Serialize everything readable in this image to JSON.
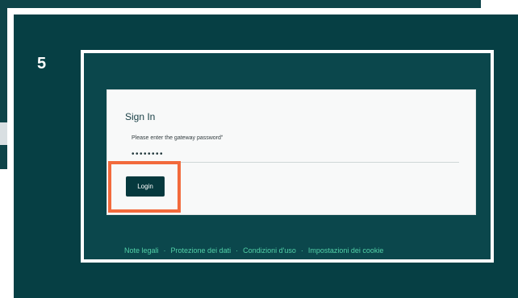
{
  "step": {
    "number": "5"
  },
  "signin": {
    "title": "Sign In",
    "password_label": "Please enter the gateway password",
    "required_marker": "*",
    "password_value": "••••••••",
    "login_label": "Login"
  },
  "footer": {
    "links": [
      "Note legali",
      "Protezione dei dati",
      "Condizioni d'uso",
      "Impostazioni dei cookie"
    ],
    "separator": "·"
  },
  "colors": {
    "background_teal": "#063f44",
    "button": "#06393e",
    "highlight": "#f26a3c",
    "footer_link": "#52d1a8"
  }
}
